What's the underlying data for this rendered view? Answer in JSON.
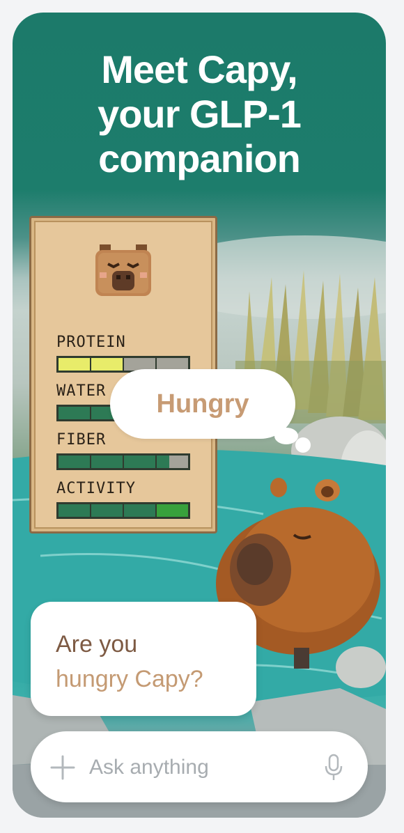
{
  "headline": {
    "line1": "Meet Capy,",
    "line2": "your GLP-1",
    "line3": "companion"
  },
  "status_panel": {
    "stats": [
      {
        "label": "PROTEIN",
        "level": 0.5
      },
      {
        "label": "WATER",
        "level": 1.0
      },
      {
        "label": "FIBER",
        "level": 0.875
      },
      {
        "label": "ACTIVITY",
        "level": 1.0
      }
    ]
  },
  "mood_bubble": {
    "text": "Hungry"
  },
  "chat_bubble": {
    "line1": "Are you",
    "line2": "hungry Capy?"
  },
  "ask_bar": {
    "placeholder": "Ask anything"
  },
  "icons": {
    "add": "plus-icon",
    "voice": "microphone-icon",
    "avatar": "capybara-face-icon"
  },
  "colors": {
    "header_teal": "#1c7a6a",
    "water_teal": "#32a8a4",
    "panel_tan": "#e6c79b",
    "bar_green": "#2d7a55",
    "bar_yellow": "#e8ec6a",
    "bar_empty": "#a4a39a",
    "bubble_text_tan": "#c79b74",
    "question_brown": "#7d5a43"
  }
}
